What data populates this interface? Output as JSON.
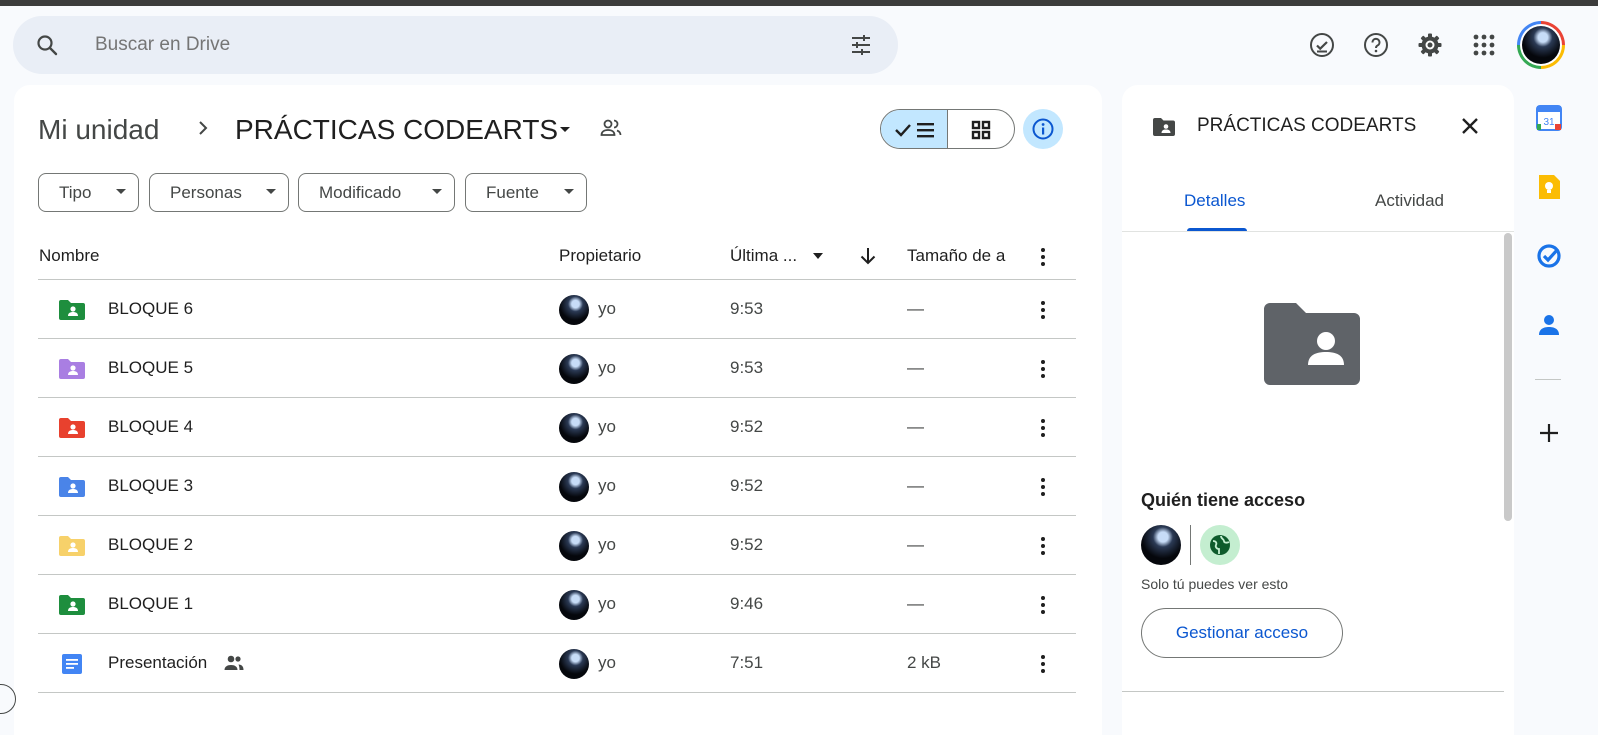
{
  "search": {
    "placeholder": "Buscar en Drive"
  },
  "topbar": {
    "icons": [
      "offline-ready-icon",
      "help-icon",
      "settings-icon",
      "apps-icon"
    ]
  },
  "breadcrumb": {
    "root": "Mi unidad",
    "current": "PRÁCTICAS CODEARTS"
  },
  "filters": [
    "Tipo",
    "Personas",
    "Modificado",
    "Fuente"
  ],
  "table": {
    "headers": {
      "name": "Nombre",
      "owner": "Propietario",
      "modified": "Última ...",
      "size": "Tamaño de a"
    },
    "rows": [
      {
        "name": "BLOQUE 6",
        "type": "shared-folder",
        "color": "#1e8e3e",
        "owner": "yo",
        "modified": "9:53",
        "size": "—"
      },
      {
        "name": "BLOQUE 5",
        "type": "shared-folder",
        "color": "#a97ee2",
        "owner": "yo",
        "modified": "9:53",
        "size": "—"
      },
      {
        "name": "BLOQUE 4",
        "type": "shared-folder",
        "color": "#e8412e",
        "owner": "yo",
        "modified": "9:52",
        "size": "—"
      },
      {
        "name": "BLOQUE 3",
        "type": "shared-folder",
        "color": "#4a84e8",
        "owner": "yo",
        "modified": "9:52",
        "size": "—"
      },
      {
        "name": "BLOQUE 2",
        "type": "shared-folder",
        "color": "#f7d16a",
        "owner": "yo",
        "modified": "9:52",
        "size": "—"
      },
      {
        "name": "BLOQUE 1",
        "type": "shared-folder",
        "color": "#1e8e3e",
        "owner": "yo",
        "modified": "9:46",
        "size": "—"
      },
      {
        "name": "Presentación",
        "type": "google-doc",
        "color": "#4285f4",
        "owner": "yo",
        "modified": "7:51",
        "size": "2 kB",
        "shared": true
      }
    ]
  },
  "details": {
    "title": "PRÁCTICAS CODEARTS",
    "tabs": [
      "Detalles",
      "Actividad"
    ],
    "active_tab": "Detalles",
    "access_heading": "Quién tiene acceso",
    "access_note": "Solo tú puedes ver esto",
    "manage_button": "Gestionar acceso"
  },
  "side_rail": [
    "calendar-icon",
    "keep-icon",
    "tasks-icon",
    "contacts-icon",
    "add-icon"
  ],
  "colors": {
    "accent": "#0b57d0",
    "selected": "#c2e7ff",
    "search_bg": "#e9eef6"
  }
}
